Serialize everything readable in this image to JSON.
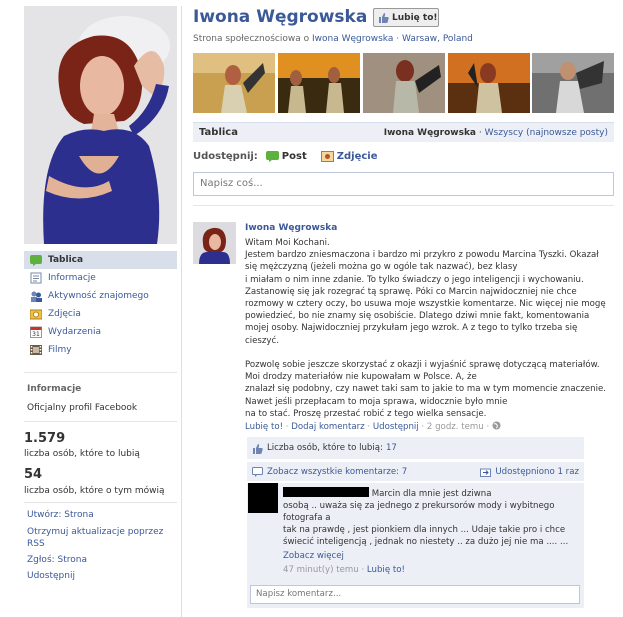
{
  "header": {
    "title": "Iwona Węgrowska",
    "like_label": "Lubię to!",
    "subtitle_prefix": "Strona społecznościowa o",
    "subtitle_link": "Iwona Węgrowska",
    "subtitle_sep": "·",
    "subtitle_location": "Warsaw, Poland"
  },
  "left_nav": {
    "items": [
      {
        "label": "Tablica",
        "icon": "wall-icon"
      },
      {
        "label": "Informacje",
        "icon": "info-icon"
      },
      {
        "label": "Aktywność znajomego",
        "icon": "friends-activity-icon"
      },
      {
        "label": "Zdjęcia",
        "icon": "photos-icon"
      },
      {
        "label": "Wydarzenia",
        "icon": "calendar-icon"
      },
      {
        "label": "Filmy",
        "icon": "film-icon"
      }
    ],
    "info_title": "Informacje",
    "info_text": "Oficjalny profil Facebook",
    "likes_count": "1.579",
    "likes_label": "liczba osób, które to lubią",
    "talking_count": "54",
    "talking_label": "liczba osób, które o tym mówią",
    "links": [
      "Utwórz: Strona",
      "Otrzymuj aktualizacje poprzez RSS",
      "Zgłoś: Strona",
      "Udostępnij"
    ]
  },
  "wall": {
    "tab": "Tablica",
    "filter_name": "Iwona Węgrowska",
    "filter_sep": "·",
    "filter_all": "Wszyscy (najnowsze posty)"
  },
  "composer": {
    "label": "Udostępnij:",
    "post": "Post",
    "photo": "Zdjęcie",
    "placeholder": "Napisz coś..."
  },
  "post": {
    "author": "Iwona Węgrowska",
    "body": "Witam Moi Kochani.\nJestem bardzo zniesmaczona i bardzo mi przykro z powodu Marcina Tyszki. Okazał się mężczyzną (jeżeli można go w ogóle tak nazwać), bez klasy\ni miałam o nim inne zdanie. To tylko świadczy o jego inteligencji i wychowaniu. Zastanowię się jak rozegrać tą sprawę. Póki co Marcin najwidoczniej nie chce rozmowy w cztery oczy, bo usuwa moje wszystkie komentarze. Nic więcej nie mogę powiedzieć, bo nie znamy się osobiście. Dlatego dziwi mnie fakt, komentowania mojej osoby. Najwidoczniej przykułam jego wzrok. A z tego to tylko trzeba się cieszyć.\n\nPozwolę sobie jeszcze skorzystać z okazji i wyjaśnić sprawę dotyczącą materiałów. Moi drodzy materiałów nie kupowałam w Polsce. A, że\nznalazł się podobny, czy nawet taki sam to jakie to ma w tym momencie znaczenie. Nawet jeśli przepłacam to moja sprawa, widocznie było mnie\nna to stać. Proszę przestać robić z tego wielka sensacje.",
    "like": "Lubię to!",
    "comment": "Dodaj komentarz",
    "share": "Udostępnij",
    "time": "2 godz. temu",
    "sep": "·",
    "likes_text": "Liczba osób, które to lubią:",
    "likes_count": "17",
    "see_all": "Zobacz wszystkie komentarze: 7",
    "shared": "Udostępniono 1 raz"
  },
  "comment": {
    "line1_tail": "Marcin dla mnie jest dziwna",
    "line2": "osobą .. uważa się za jednego z prekursorów mody i wybitnego fotografa a",
    "line3": "tak na prawdę , jest pionkiem dla innych ... Udaje takie pro i chce świecić inteligencją , jednak no niestety .. za dużo jej nie ma .... ...",
    "see_more": "Zobacz więcej",
    "time": "47 minut(y) temu",
    "sep": "·",
    "like": "Lubię to!",
    "input_placeholder": "Napisz komentarz..."
  }
}
